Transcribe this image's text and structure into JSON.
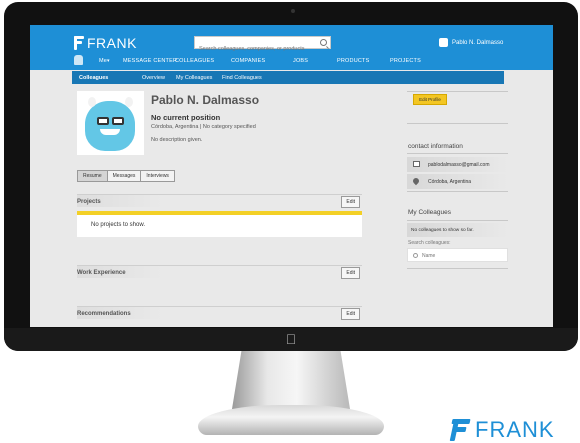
{
  "app": {
    "brand": "FRANK"
  },
  "search": {
    "placeholder": "Search colleagues, companies, or products"
  },
  "user": {
    "name": "Pablo N. Dalmasso"
  },
  "menu": {
    "items": [
      "Me",
      "MESSAGE CENTER",
      "COLLEAGUES",
      "COMPANIES",
      "JOBS",
      "PRODUCTS",
      "PROJECTS"
    ]
  },
  "subnav": {
    "items": [
      "Colleagues",
      "Overview",
      "My Colleagues",
      "Find Colleagues"
    ]
  },
  "profile": {
    "name": "Pablo N. Dalmasso",
    "position": "No current position",
    "location": "Córdoba, Argentina | No category specified",
    "description": "No description given."
  },
  "tabs": [
    "Resume",
    "Messages",
    "Interviews"
  ],
  "sections": {
    "projects": {
      "title": "Projects",
      "edit": "Edit",
      "empty": "No projects to show."
    },
    "work": {
      "title": "Work Experience",
      "edit": "Edit"
    },
    "recommendations": {
      "title": "Recommendations",
      "edit": "Edit"
    }
  },
  "sidebar": {
    "edit_profile": "Edit Profile",
    "contact_title": "contact information",
    "email": "pablodalmasso@gmail.com",
    "city": "Córdoba, Argentina",
    "colleagues_title": "My Colleagues",
    "no_colleagues": "No colleagues to show so far.",
    "search_label": "Search colleagues:",
    "name_placeholder": "Name"
  },
  "colors": {
    "accent": "#1e8fd6",
    "highlight": "#f3d026"
  }
}
